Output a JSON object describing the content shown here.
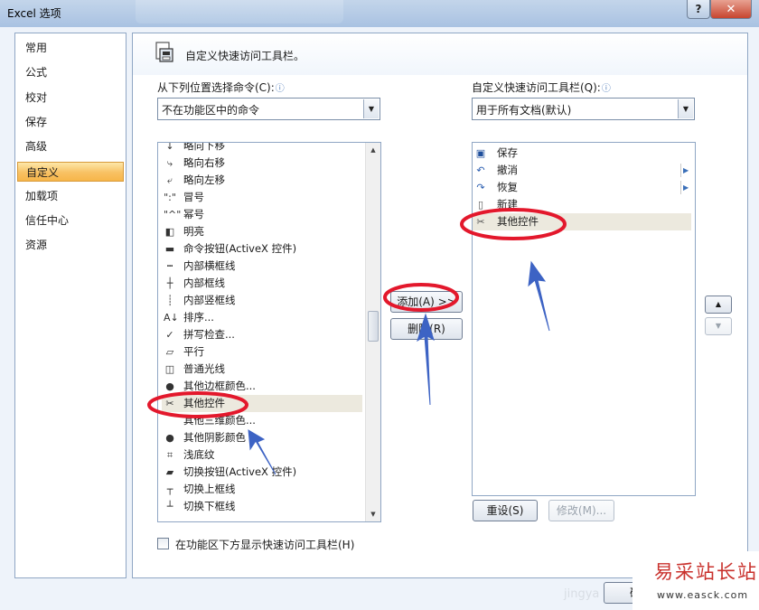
{
  "window": {
    "title": "Excel 选项",
    "help_label": "?",
    "close_label": "x"
  },
  "nav": {
    "items": [
      {
        "label": "常用"
      },
      {
        "label": "公式"
      },
      {
        "label": "校对"
      },
      {
        "label": "保存"
      },
      {
        "label": "高级"
      },
      {
        "label": "自定义",
        "active": true
      },
      {
        "label": "加载项"
      },
      {
        "label": "信任中心"
      },
      {
        "label": "资源"
      }
    ]
  },
  "main": {
    "heading": "自定义快速访问工具栏。",
    "left_label": "从下列位置选择命令(C):",
    "left_combo_value": "不在功能区中的命令",
    "right_label": "自定义快速访问工具栏(Q):",
    "right_combo_value": "用于所有文档(默认)",
    "commands": [
      {
        "label": "略向下移",
        "icon": "nudge-down-icon",
        "glyph": "↓"
      },
      {
        "label": "略向右移",
        "icon": "nudge-right-icon",
        "glyph": "⤷"
      },
      {
        "label": "略向左移",
        "icon": "nudge-left-icon",
        "glyph": "⤶"
      },
      {
        "label": "冒号",
        "icon": "colon-icon",
        "glyph": "\":\""
      },
      {
        "label": "幂号",
        "icon": "caret-icon",
        "glyph": "\"^\""
      },
      {
        "label": "明亮",
        "icon": "brightness-icon",
        "glyph": "◧"
      },
      {
        "label": "命令按钮(ActiveX 控件)",
        "icon": "command-button-icon",
        "glyph": "▬"
      },
      {
        "label": "内部横框线",
        "icon": "inside-horizontal-border-icon",
        "glyph": "┅"
      },
      {
        "label": "内部框线",
        "icon": "inside-borders-icon",
        "glyph": "┼"
      },
      {
        "label": "内部竖框线",
        "icon": "inside-vertical-border-icon",
        "glyph": "┊"
      },
      {
        "label": "排序...",
        "icon": "sort-icon",
        "glyph": "A↓"
      },
      {
        "label": "拼写检查...",
        "icon": "spelling-icon",
        "glyph": "✓"
      },
      {
        "label": "平行",
        "icon": "parallel-icon",
        "glyph": "▱"
      },
      {
        "label": "普通光线",
        "icon": "normal-lighting-icon",
        "glyph": "◫"
      },
      {
        "label": "其他边框颜色...",
        "icon": "border-color-icon",
        "glyph": "●"
      },
      {
        "label": "其他控件",
        "icon": "more-controls-icon",
        "glyph": "✂",
        "selected": true
      },
      {
        "label": "其他三维颜色...",
        "icon": "3d-color-icon",
        "glyph": ""
      },
      {
        "label": "其他阴影颜色",
        "icon": "shadow-color-icon",
        "glyph": "●"
      },
      {
        "label": "浅底纹",
        "icon": "light-shading-icon",
        "glyph": "⌗"
      },
      {
        "label": "切换按钮(ActiveX 控件)",
        "icon": "toggle-button-icon",
        "glyph": "▰"
      },
      {
        "label": "切换上框线",
        "icon": "top-border-icon",
        "glyph": "┬"
      },
      {
        "label": "切换下框线",
        "icon": "bottom-border-icon",
        "glyph": "┴"
      }
    ],
    "add_button": "添加(A) >>",
    "remove_button": "删除(R)",
    "toolbar_items": [
      {
        "label": "保存",
        "icon": "save-icon",
        "glyph": "▣",
        "color": "#1f4f9c"
      },
      {
        "label": "撤消",
        "icon": "undo-icon",
        "glyph": "↶",
        "color": "#2a5db0",
        "submenu": true
      },
      {
        "label": "恢复",
        "icon": "redo-icon",
        "glyph": "↷",
        "color": "#2a5db0",
        "submenu": true
      },
      {
        "label": "新建",
        "icon": "new-document-icon",
        "glyph": "▯",
        "color": "#555555"
      },
      {
        "label": "其他控件",
        "icon": "more-controls-icon",
        "glyph": "✂",
        "color": "#555555",
        "selected": true
      }
    ],
    "move_up_label": "▲",
    "move_down_label": "▼",
    "reset_button": "重设(S)",
    "modify_button": "修改(M)...",
    "show_below_ribbon_checkbox": "在功能区下方显示快速访问工具栏(H)",
    "ok_button": "确定"
  },
  "watermark": {
    "title": "易采站长站",
    "url": "www.easck.com",
    "faint_text": "jingya"
  },
  "annotation_color": "#e3182c",
  "arrow_color": "#3d63c4"
}
